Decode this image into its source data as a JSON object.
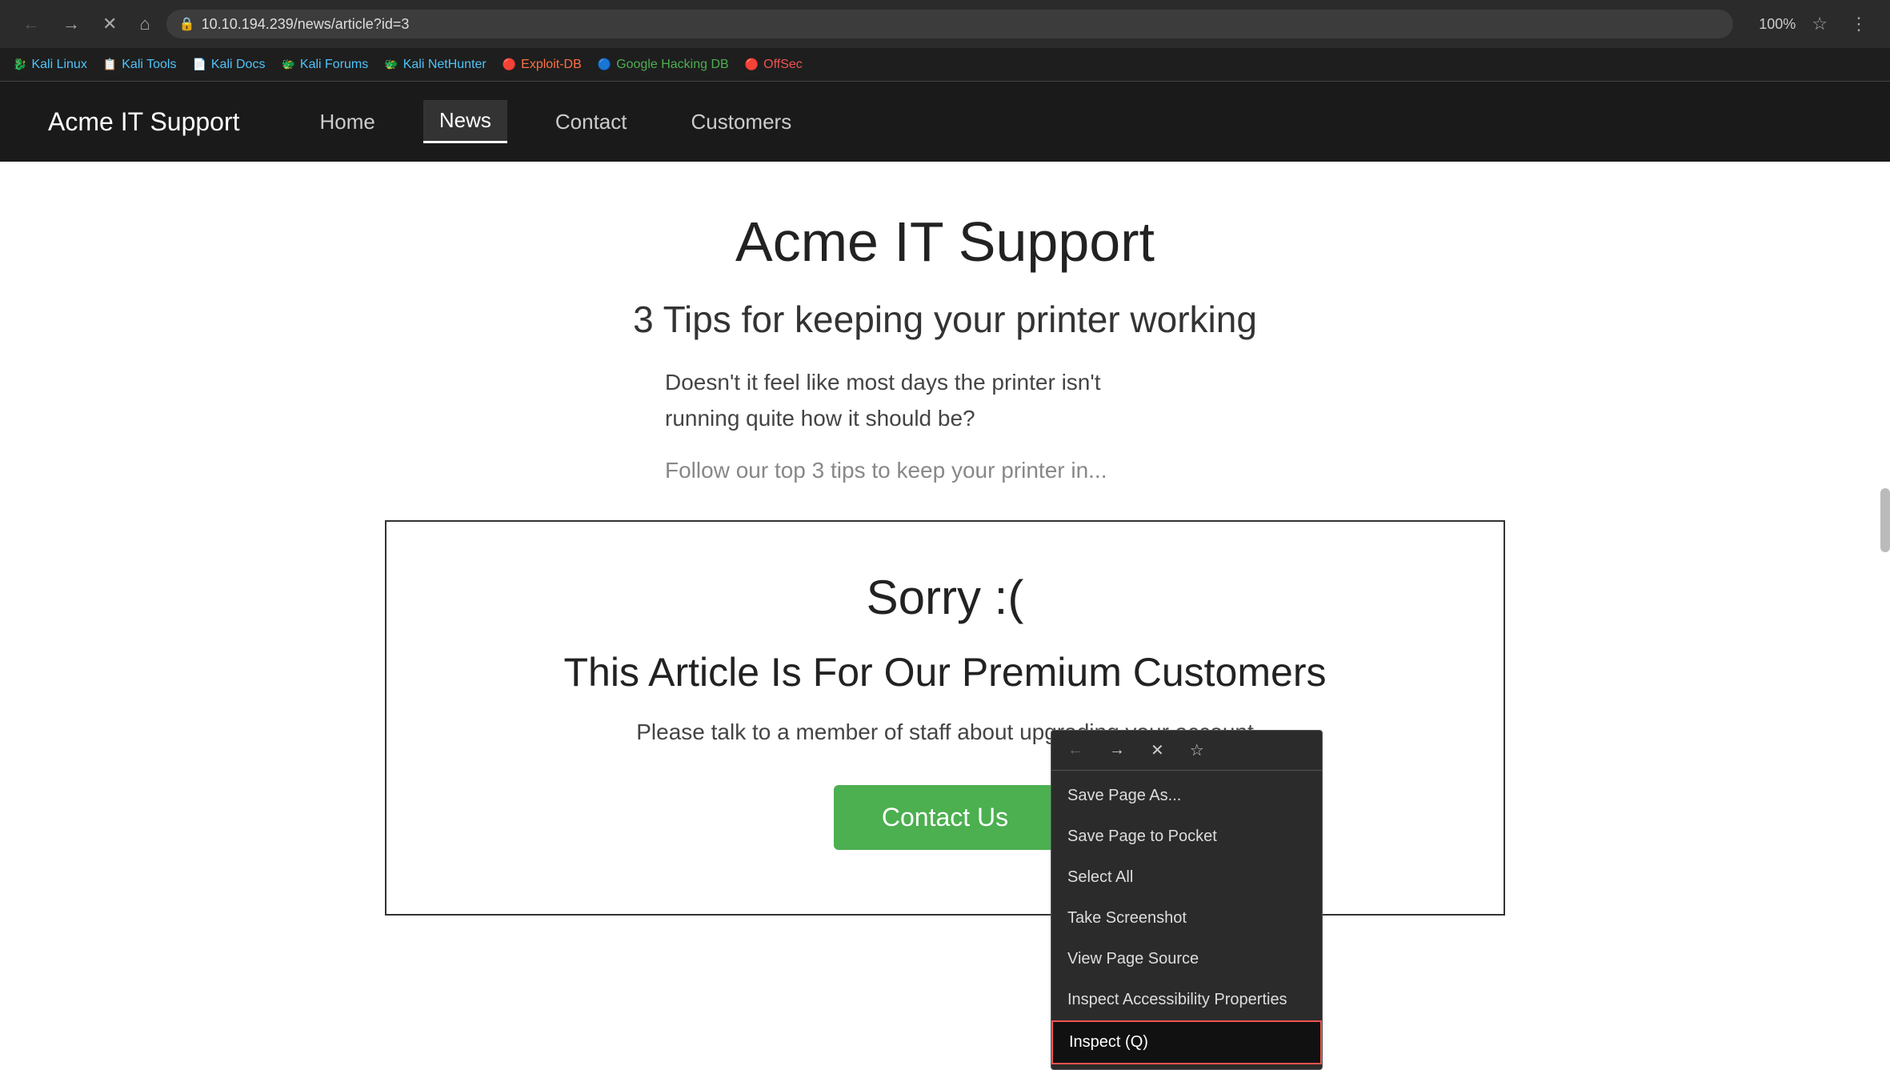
{
  "browser": {
    "url": "10.10.194.239/news/article?id=3",
    "zoom": "100%",
    "back_disabled": false,
    "forward_disabled": false
  },
  "bookmarks": [
    {
      "label": "Kali Linux",
      "icon": "🐉",
      "class": "kali"
    },
    {
      "label": "Kali Tools",
      "icon": "📋",
      "class": "kali-tools"
    },
    {
      "label": "Kali Docs",
      "icon": "📄",
      "class": "kali-docs"
    },
    {
      "label": "Kali Forums",
      "icon": "🐲",
      "class": "kali-forums"
    },
    {
      "label": "Kali NetHunter",
      "icon": "🐲",
      "class": "kali-nethunter"
    },
    {
      "label": "Exploit-DB",
      "icon": "🔴",
      "class": "exploit-db"
    },
    {
      "label": "Google Hacking DB",
      "icon": "🔵",
      "class": "google-hacking"
    },
    {
      "label": "OffSec",
      "icon": "🔴",
      "class": "offsec"
    }
  ],
  "navbar": {
    "brand": "Acme IT Support",
    "items": [
      {
        "label": "Home",
        "active": false
      },
      {
        "label": "News",
        "active": true
      },
      {
        "label": "Contact",
        "active": false
      },
      {
        "label": "Customers",
        "active": false
      }
    ]
  },
  "page": {
    "title": "Acme IT Support",
    "article_title": "3 Tips for keeping your printer working",
    "excerpt_1": "Doesn't it feel like most days the printer isn't\nrunning quite how it should be?",
    "excerpt_2": "Follow our top 3 tips to keep your printer in..."
  },
  "paywall": {
    "sorry": "Sorry :(",
    "subtitle": "This Article Is For Our Premium Customers",
    "text": "Please talk to a member of staff about upgrading your account",
    "cta": "Contact Us"
  },
  "context_menu": {
    "items": [
      "Save Page As...",
      "Save Page to Pocket",
      "Select All",
      "Take Screenshot",
      "View Page Source",
      "Inspect Accessibility Properties",
      "Inspect (Q)"
    ],
    "highlighted_index": 6
  }
}
